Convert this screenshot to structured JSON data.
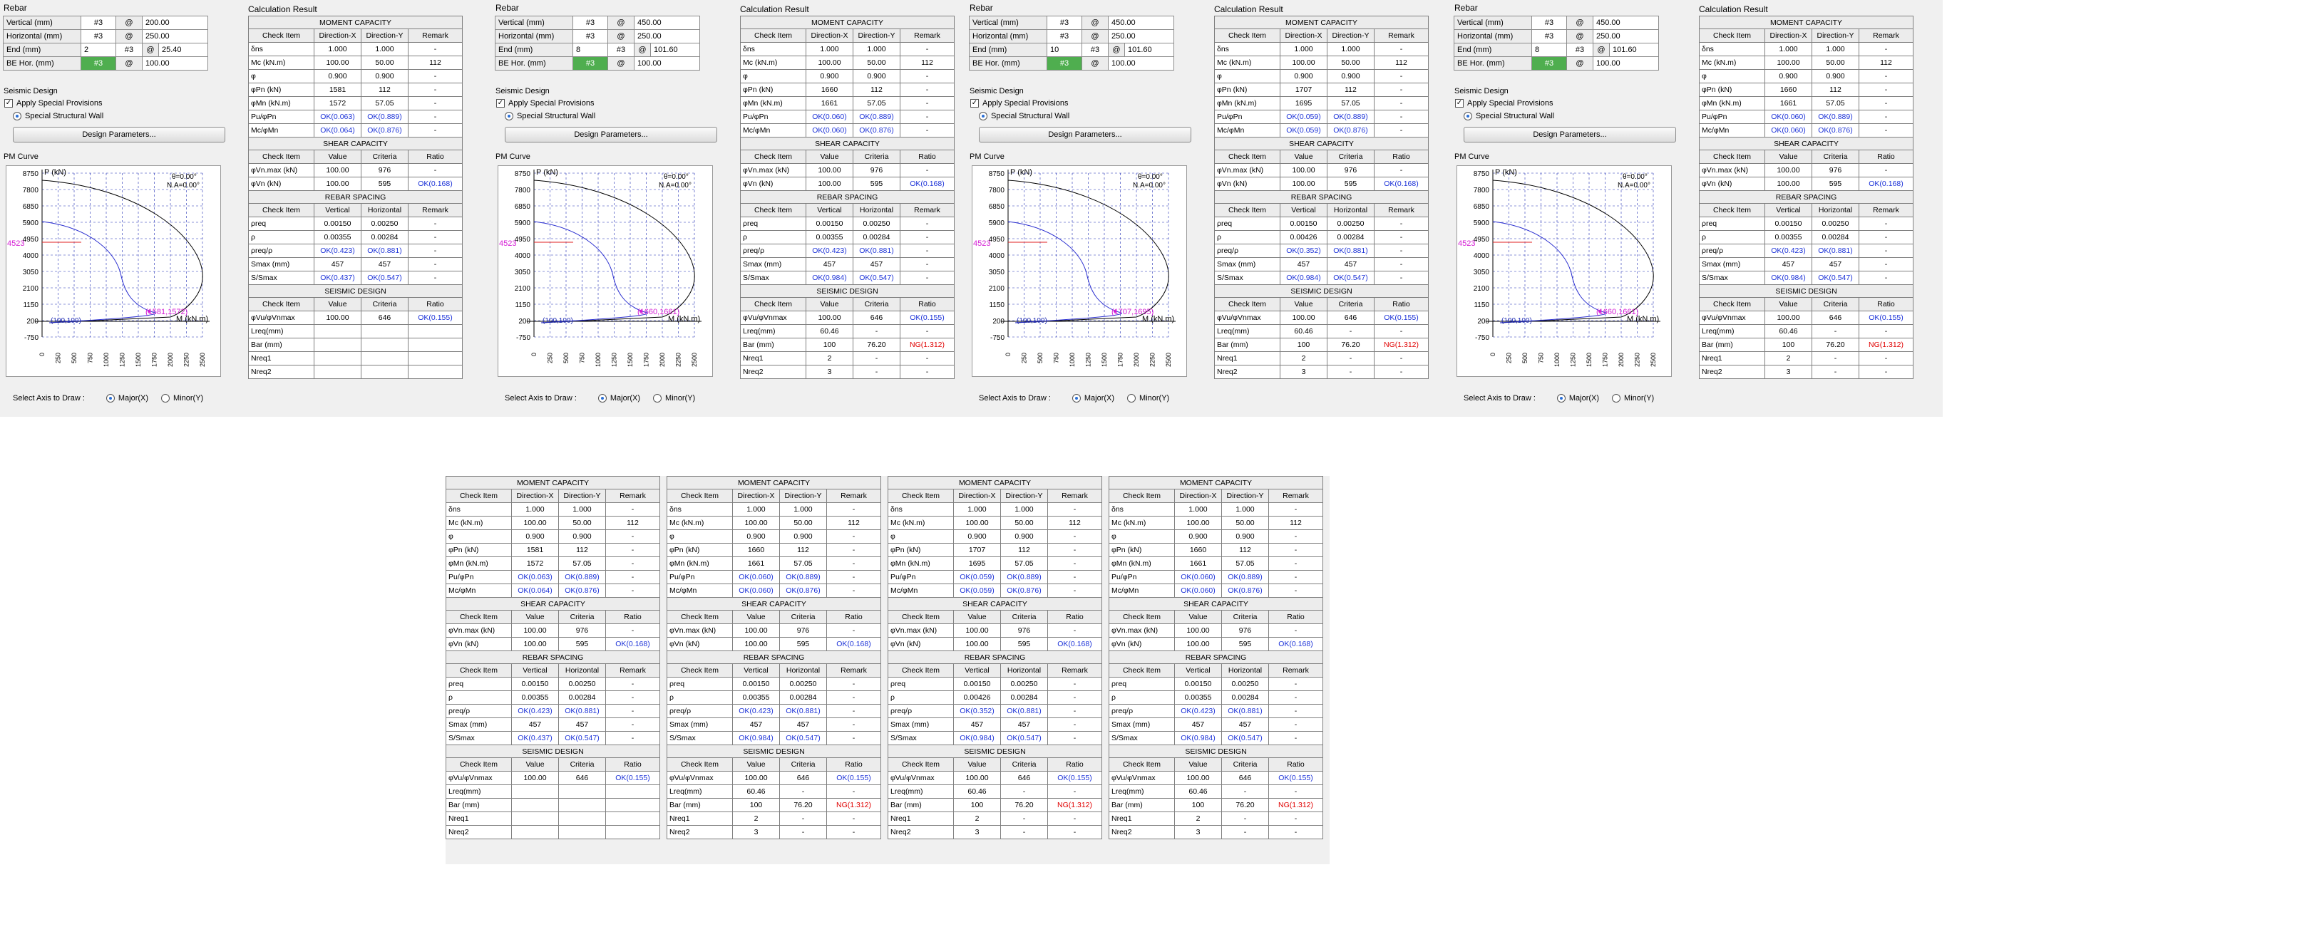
{
  "labels": {
    "rebar": "Rebar",
    "calc_result": "Calculation Result",
    "seismic_design": "Seismic Design",
    "apply_special": "Apply Special Provisions",
    "special_wall": "Special Structural Wall",
    "design_params": "Design Parameters...",
    "pm_curve": "PM Curve",
    "select_axis": "Select Axis to Draw :",
    "major": "Major(X)",
    "minor": "Minor(Y)",
    "vertical": "Vertical (mm)",
    "horizontal": "Horizontal (mm)",
    "end": "End (mm)",
    "be_hor": "BE Hor. (mm)",
    "hash3": "#3",
    "at": "@",
    "check_item": "Check Item",
    "dir_x": "Direction-X",
    "dir_y": "Direction-Y",
    "value": "Value",
    "criteria": "Criteria",
    "ratio": "Ratio",
    "remark": "Remark",
    "vert_col": "Vertical",
    "horiz_col": "Horizontal",
    "moment_capacity": "MOMENT CAPACITY",
    "shear_capacity": "SHEAR CAPACITY",
    "rebar_spacing": "REBAR SPACING",
    "seismic_design_sec": "SEISMIC DESIGN",
    "pm_p": "P (kN)",
    "pm_m": "M (kN.m)",
    "pm_theta": "θ=0.00°",
    "pm_na": "N.A=0.00°",
    "pm_origin": "(100,100)"
  },
  "panels": [
    {
      "rebar": {
        "vertical": {
          "spacing": "200.00"
        },
        "horizontal": {
          "spacing": "250.00"
        },
        "end": {
          "count": "2",
          "size": "#3",
          "spacing": "25.40"
        },
        "be": {
          "size": "#3",
          "spacing": "100.00"
        }
      },
      "pm": {
        "p_mark": "4523",
        "pt_label": "(1581,1572)"
      },
      "calc": {
        "moment": [
          [
            "δns",
            "1.000",
            "1.000",
            "-"
          ],
          [
            "Mc (kN.m)",
            "100.00",
            "50.00",
            "112"
          ],
          [
            "φ",
            "0.900",
            "0.900",
            "-"
          ],
          [
            "φPn (kN)",
            "1581",
            "112",
            "-"
          ],
          [
            "φMn (kN.m)",
            "1572",
            "57.05",
            "-"
          ],
          [
            "Pu/φPn",
            "OK(0.063)",
            "OK(0.889)",
            "-"
          ],
          [
            "Mc/φMn",
            "OK(0.064)",
            "OK(0.876)",
            "-"
          ]
        ],
        "shear": [
          [
            "φVn.max (kN)",
            "100.00",
            "976",
            "-"
          ],
          [
            "φVn (kN)",
            "100.00",
            "595",
            "OK(0.168)"
          ]
        ],
        "spacing": [
          [
            "ρreq",
            "0.00150",
            "0.00250",
            "-"
          ],
          [
            "ρ",
            "0.00355",
            "0.00284",
            "-"
          ],
          [
            "ρreq/ρ",
            "OK(0.423)",
            "OK(0.881)",
            "-"
          ],
          [
            "Smax (mm)",
            "457",
            "457",
            "-"
          ],
          [
            "S/Smax",
            "OK(0.437)",
            "OK(0.547)",
            "-"
          ]
        ],
        "seismic": [
          [
            "φVu/φVnmax",
            "100.00",
            "646",
            "OK(0.155)"
          ],
          [
            "Lreq(mm)",
            "",
            "",
            ""
          ],
          [
            "Bar (mm)",
            "",
            "",
            ""
          ],
          [
            "Nreq1",
            "",
            "",
            ""
          ],
          [
            "Nreq2",
            "",
            "",
            ""
          ]
        ]
      }
    },
    {
      "rebar": {
        "vertical": {
          "spacing": "450.00"
        },
        "horizontal": {
          "spacing": "250.00"
        },
        "end": {
          "count": "8",
          "size": "#3",
          "spacing": "101.60"
        },
        "be": {
          "size": "#3",
          "spacing": "100.00"
        }
      },
      "pm": {
        "p_mark": "4523",
        "pt_label": "(1660,1661)"
      },
      "calc": {
        "moment": [
          [
            "δns",
            "1.000",
            "1.000",
            "-"
          ],
          [
            "Mc (kN.m)",
            "100.00",
            "50.00",
            "112"
          ],
          [
            "φ",
            "0.900",
            "0.900",
            "-"
          ],
          [
            "φPn (kN)",
            "1660",
            "112",
            "-"
          ],
          [
            "φMn (kN.m)",
            "1661",
            "57.05",
            "-"
          ],
          [
            "Pu/φPn",
            "OK(0.060)",
            "OK(0.889)",
            "-"
          ],
          [
            "Mc/φMn",
            "OK(0.060)",
            "OK(0.876)",
            "-"
          ]
        ],
        "shear": [
          [
            "φVn.max (kN)",
            "100.00",
            "976",
            "-"
          ],
          [
            "φVn (kN)",
            "100.00",
            "595",
            "OK(0.168)"
          ]
        ],
        "spacing": [
          [
            "ρreq",
            "0.00150",
            "0.00250",
            "-"
          ],
          [
            "ρ",
            "0.00355",
            "0.00284",
            "-"
          ],
          [
            "ρreq/ρ",
            "OK(0.423)",
            "OK(0.881)",
            "-"
          ],
          [
            "Smax (mm)",
            "457",
            "457",
            "-"
          ],
          [
            "S/Smax",
            "OK(0.984)",
            "OK(0.547)",
            "-"
          ]
        ],
        "seismic": [
          [
            "φVu/φVnmax",
            "100.00",
            "646",
            "OK(0.155)"
          ],
          [
            "Lreq(mm)",
            "60.46",
            "-",
            "-"
          ],
          [
            "Bar (mm)",
            "100",
            "76.20",
            "NG(1.312)"
          ],
          [
            "Nreq1",
            "2",
            "-",
            "-"
          ],
          [
            "Nreq2",
            "3",
            "-",
            "-"
          ]
        ]
      }
    },
    {
      "rebar": {
        "vertical": {
          "spacing": "450.00"
        },
        "horizontal": {
          "spacing": "250.00"
        },
        "end": {
          "count": "10",
          "size": "#3",
          "spacing": "101.60"
        },
        "be": {
          "size": "#3",
          "spacing": "100.00"
        }
      },
      "pm": {
        "p_mark": "4523",
        "pt_label": "(1707,1695)"
      },
      "calc": {
        "moment": [
          [
            "δns",
            "1.000",
            "1.000",
            "-"
          ],
          [
            "Mc (kN.m)",
            "100.00",
            "50.00",
            "112"
          ],
          [
            "φ",
            "0.900",
            "0.900",
            "-"
          ],
          [
            "φPn (kN)",
            "1707",
            "112",
            "-"
          ],
          [
            "φMn (kN.m)",
            "1695",
            "57.05",
            "-"
          ],
          [
            "Pu/φPn",
            "OK(0.059)",
            "OK(0.889)",
            "-"
          ],
          [
            "Mc/φMn",
            "OK(0.059)",
            "OK(0.876)",
            "-"
          ]
        ],
        "shear": [
          [
            "φVn.max (kN)",
            "100.00",
            "976",
            "-"
          ],
          [
            "φVn (kN)",
            "100.00",
            "595",
            "OK(0.168)"
          ]
        ],
        "spacing": [
          [
            "ρreq",
            "0.00150",
            "0.00250",
            "-"
          ],
          [
            "ρ",
            "0.00426",
            "0.00284",
            "-"
          ],
          [
            "ρreq/ρ",
            "OK(0.352)",
            "OK(0.881)",
            "-"
          ],
          [
            "Smax (mm)",
            "457",
            "457",
            "-"
          ],
          [
            "S/Smax",
            "OK(0.984)",
            "OK(0.547)",
            "-"
          ]
        ],
        "seismic": [
          [
            "φVu/φVnmax",
            "100.00",
            "646",
            "OK(0.155)"
          ],
          [
            "Lreq(mm)",
            "60.46",
            "-",
            "-"
          ],
          [
            "Bar (mm)",
            "100",
            "76.20",
            "NG(1.312)"
          ],
          [
            "Nreq1",
            "2",
            "-",
            "-"
          ],
          [
            "Nreq2",
            "3",
            "-",
            "-"
          ]
        ]
      }
    },
    {
      "rebar": {
        "vertical": {
          "spacing": "450.00"
        },
        "horizontal": {
          "spacing": "250.00"
        },
        "end": {
          "count": "8",
          "size": "#3",
          "spacing": "101.60"
        },
        "be": {
          "size": "#3",
          "spacing": "100.00"
        }
      },
      "pm": {
        "p_mark": "4523",
        "pt_label": "(1660,1661)"
      },
      "calc": {
        "moment": [
          [
            "δns",
            "1.000",
            "1.000",
            "-"
          ],
          [
            "Mc (kN.m)",
            "100.00",
            "50.00",
            "112"
          ],
          [
            "φ",
            "0.900",
            "0.900",
            "-"
          ],
          [
            "φPn (kN)",
            "1660",
            "112",
            "-"
          ],
          [
            "φMn (kN.m)",
            "1661",
            "57.05",
            "-"
          ],
          [
            "Pu/φPn",
            "OK(0.060)",
            "OK(0.889)",
            "-"
          ],
          [
            "Mc/φMn",
            "OK(0.060)",
            "OK(0.876)",
            "-"
          ]
        ],
        "shear": [
          [
            "φVn.max (kN)",
            "100.00",
            "976",
            "-"
          ],
          [
            "φVn (kN)",
            "100.00",
            "595",
            "OK(0.168)"
          ]
        ],
        "spacing": [
          [
            "ρreq",
            "0.00150",
            "0.00250",
            "-"
          ],
          [
            "ρ",
            "0.00355",
            "0.00284",
            "-"
          ],
          [
            "ρreq/ρ",
            "OK(0.423)",
            "OK(0.881)",
            "-"
          ],
          [
            "Smax (mm)",
            "457",
            "457",
            "-"
          ],
          [
            "S/Smax",
            "OK(0.984)",
            "OK(0.547)",
            "-"
          ]
        ],
        "seismic": [
          [
            "φVu/φVnmax",
            "100.00",
            "646",
            "OK(0.155)"
          ],
          [
            "Lreq(mm)",
            "60.46",
            "-",
            "-"
          ],
          [
            "Bar (mm)",
            "100",
            "76.20",
            "NG(1.312)"
          ],
          [
            "Nreq1",
            "2",
            "-",
            "-"
          ],
          [
            "Nreq2",
            "3",
            "-",
            "-"
          ]
        ]
      }
    }
  ],
  "pm_axis": {
    "y_ticks": [
      "8750",
      "7800",
      "6850",
      "5900",
      "4950",
      "4000",
      "3050",
      "2100",
      "1150",
      "200",
      "-750"
    ],
    "x_ticks": [
      "0",
      "250",
      "500",
      "750",
      "1000",
      "1250",
      "1500",
      "1750",
      "2000",
      "2250",
      "2500"
    ]
  },
  "bottom": [
    0,
    1,
    2,
    3
  ]
}
